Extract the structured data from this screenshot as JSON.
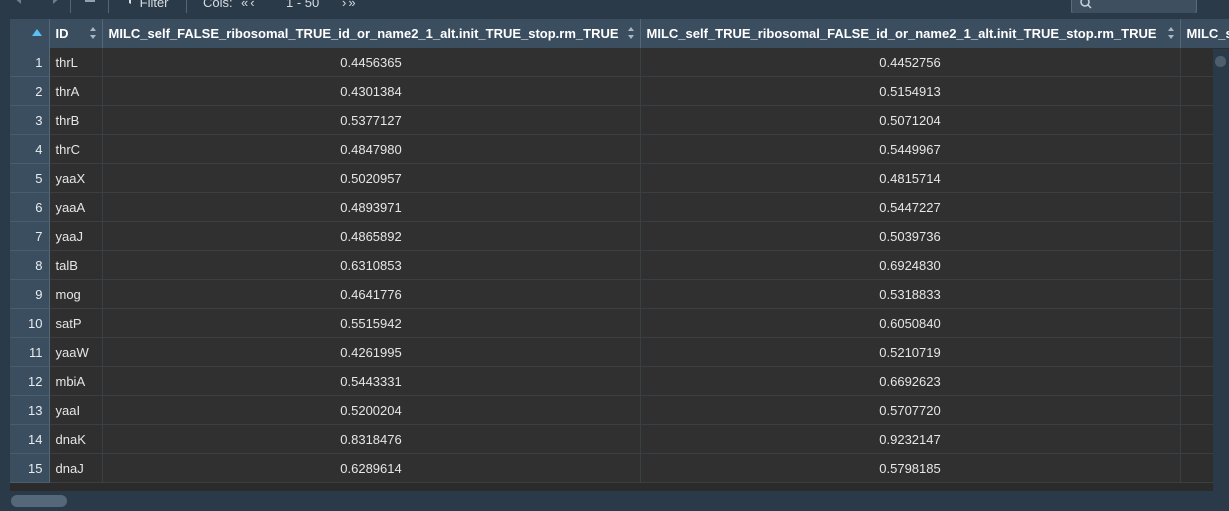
{
  "toolbar": {
    "filter_label": "Filter",
    "cols_label": "Cols:",
    "cols_prev": "«‹",
    "cols_range": "1 - 50",
    "cols_next": "›»"
  },
  "table": {
    "id_header": "ID",
    "columns": [
      "MILC_self_FALSE_ribosomal_TRUE_id_or_name2_1_alt.init_TRUE_stop.rm_TRUE",
      "MILC_self_TRUE_ribosomal_FALSE_id_or_name2_1_alt.init_TRUE_stop.rm_TRUE",
      "MILC_s"
    ],
    "rows": [
      {
        "n": "1",
        "id": "thrL",
        "v1": "0.4456365",
        "v2": "0.4452756"
      },
      {
        "n": "2",
        "id": "thrA",
        "v1": "0.4301384",
        "v2": "0.5154913"
      },
      {
        "n": "3",
        "id": "thrB",
        "v1": "0.5377127",
        "v2": "0.5071204"
      },
      {
        "n": "4",
        "id": "thrC",
        "v1": "0.4847980",
        "v2": "0.5449967"
      },
      {
        "n": "5",
        "id": "yaaX",
        "v1": "0.5020957",
        "v2": "0.4815714"
      },
      {
        "n": "6",
        "id": "yaaA",
        "v1": "0.4893971",
        "v2": "0.5447227"
      },
      {
        "n": "7",
        "id": "yaaJ",
        "v1": "0.4865892",
        "v2": "0.5039736"
      },
      {
        "n": "8",
        "id": "talB",
        "v1": "0.6310853",
        "v2": "0.6924830"
      },
      {
        "n": "9",
        "id": "mog",
        "v1": "0.4641776",
        "v2": "0.5318833"
      },
      {
        "n": "10",
        "id": "satP",
        "v1": "0.5515942",
        "v2": "0.6050840"
      },
      {
        "n": "11",
        "id": "yaaW",
        "v1": "0.4261995",
        "v2": "0.5210719"
      },
      {
        "n": "12",
        "id": "mbiA",
        "v1": "0.5443331",
        "v2": "0.6692623"
      },
      {
        "n": "13",
        "id": "yaaI",
        "v1": "0.5200204",
        "v2": "0.5707720"
      },
      {
        "n": "14",
        "id": "dnaK",
        "v1": "0.8318476",
        "v2": "0.9232147"
      },
      {
        "n": "15",
        "id": "dnaJ",
        "v1": "0.6289614",
        "v2": "0.5798185"
      }
    ]
  },
  "colors": {
    "header_bg": "#3b4e60",
    "toolbar_bg": "#2b3a48",
    "cell_bg": "#303030",
    "sort_accent": "#5bc0f2"
  },
  "icons": [
    "back-arrow-icon",
    "forward-arrow-icon",
    "export-icon",
    "filter-icon",
    "search-icon"
  ]
}
